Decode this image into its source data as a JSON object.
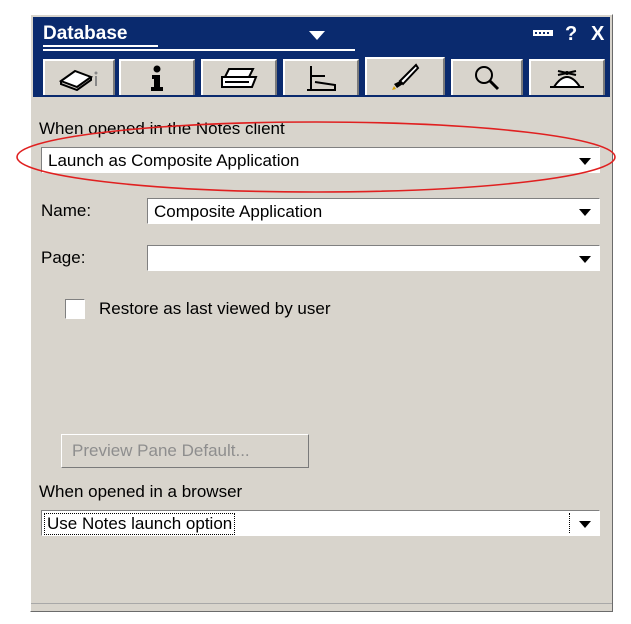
{
  "window": {
    "title": "Database",
    "help_label": "?",
    "close_label": "X"
  },
  "tabs": [
    {
      "name": "basics",
      "icon": "database-info-icon"
    },
    {
      "name": "info",
      "icon": "info-icon"
    },
    {
      "name": "print",
      "icon": "printer-icon"
    },
    {
      "name": "design",
      "icon": "design-ruler-icon"
    },
    {
      "name": "launch",
      "icon": "launch-rocket-icon",
      "selected": true
    },
    {
      "name": "search",
      "icon": "magnifier-icon"
    },
    {
      "name": "advanced",
      "icon": "propeller-hat-icon"
    }
  ],
  "notes_client": {
    "section_label": "When opened in the Notes client",
    "launch_value": "Launch as Composite Application",
    "name_label": "Name:",
    "name_value": "Composite Application",
    "page_label": "Page:",
    "page_value": "",
    "restore_label": "Restore as last viewed by user",
    "restore_checked": false,
    "preview_button": "Preview Pane Default..."
  },
  "browser": {
    "section_label": "When opened in a browser",
    "launch_value": "Use Notes launch option"
  },
  "colors": {
    "titlebar": "#0a2a6e",
    "panel": "#d8d4cc",
    "highlight": "#e02020"
  }
}
